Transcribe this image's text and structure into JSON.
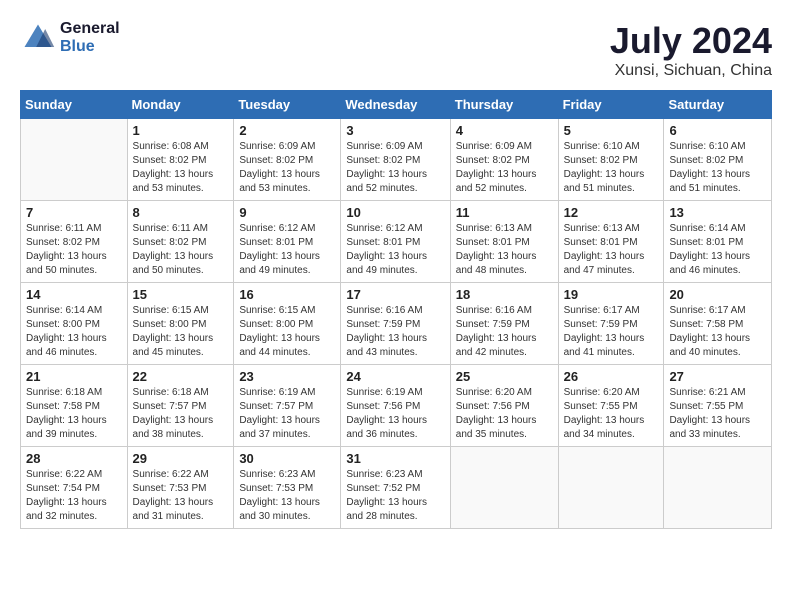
{
  "logo": {
    "line1": "General",
    "line2": "Blue"
  },
  "title": "July 2024",
  "subtitle": "Xunsi, Sichuan, China",
  "days_of_week": [
    "Sunday",
    "Monday",
    "Tuesday",
    "Wednesday",
    "Thursday",
    "Friday",
    "Saturday"
  ],
  "weeks": [
    [
      {
        "day": "",
        "detail": ""
      },
      {
        "day": "1",
        "detail": "Sunrise: 6:08 AM\nSunset: 8:02 PM\nDaylight: 13 hours\nand 53 minutes."
      },
      {
        "day": "2",
        "detail": "Sunrise: 6:09 AM\nSunset: 8:02 PM\nDaylight: 13 hours\nand 53 minutes."
      },
      {
        "day": "3",
        "detail": "Sunrise: 6:09 AM\nSunset: 8:02 PM\nDaylight: 13 hours\nand 52 minutes."
      },
      {
        "day": "4",
        "detail": "Sunrise: 6:09 AM\nSunset: 8:02 PM\nDaylight: 13 hours\nand 52 minutes."
      },
      {
        "day": "5",
        "detail": "Sunrise: 6:10 AM\nSunset: 8:02 PM\nDaylight: 13 hours\nand 51 minutes."
      },
      {
        "day": "6",
        "detail": "Sunrise: 6:10 AM\nSunset: 8:02 PM\nDaylight: 13 hours\nand 51 minutes."
      }
    ],
    [
      {
        "day": "7",
        "detail": "Sunrise: 6:11 AM\nSunset: 8:02 PM\nDaylight: 13 hours\nand 50 minutes."
      },
      {
        "day": "8",
        "detail": "Sunrise: 6:11 AM\nSunset: 8:02 PM\nDaylight: 13 hours\nand 50 minutes."
      },
      {
        "day": "9",
        "detail": "Sunrise: 6:12 AM\nSunset: 8:01 PM\nDaylight: 13 hours\nand 49 minutes."
      },
      {
        "day": "10",
        "detail": "Sunrise: 6:12 AM\nSunset: 8:01 PM\nDaylight: 13 hours\nand 49 minutes."
      },
      {
        "day": "11",
        "detail": "Sunrise: 6:13 AM\nSunset: 8:01 PM\nDaylight: 13 hours\nand 48 minutes."
      },
      {
        "day": "12",
        "detail": "Sunrise: 6:13 AM\nSunset: 8:01 PM\nDaylight: 13 hours\nand 47 minutes."
      },
      {
        "day": "13",
        "detail": "Sunrise: 6:14 AM\nSunset: 8:01 PM\nDaylight: 13 hours\nand 46 minutes."
      }
    ],
    [
      {
        "day": "14",
        "detail": "Sunrise: 6:14 AM\nSunset: 8:00 PM\nDaylight: 13 hours\nand 46 minutes."
      },
      {
        "day": "15",
        "detail": "Sunrise: 6:15 AM\nSunset: 8:00 PM\nDaylight: 13 hours\nand 45 minutes."
      },
      {
        "day": "16",
        "detail": "Sunrise: 6:15 AM\nSunset: 8:00 PM\nDaylight: 13 hours\nand 44 minutes."
      },
      {
        "day": "17",
        "detail": "Sunrise: 6:16 AM\nSunset: 7:59 PM\nDaylight: 13 hours\nand 43 minutes."
      },
      {
        "day": "18",
        "detail": "Sunrise: 6:16 AM\nSunset: 7:59 PM\nDaylight: 13 hours\nand 42 minutes."
      },
      {
        "day": "19",
        "detail": "Sunrise: 6:17 AM\nSunset: 7:59 PM\nDaylight: 13 hours\nand 41 minutes."
      },
      {
        "day": "20",
        "detail": "Sunrise: 6:17 AM\nSunset: 7:58 PM\nDaylight: 13 hours\nand 40 minutes."
      }
    ],
    [
      {
        "day": "21",
        "detail": "Sunrise: 6:18 AM\nSunset: 7:58 PM\nDaylight: 13 hours\nand 39 minutes."
      },
      {
        "day": "22",
        "detail": "Sunrise: 6:18 AM\nSunset: 7:57 PM\nDaylight: 13 hours\nand 38 minutes."
      },
      {
        "day": "23",
        "detail": "Sunrise: 6:19 AM\nSunset: 7:57 PM\nDaylight: 13 hours\nand 37 minutes."
      },
      {
        "day": "24",
        "detail": "Sunrise: 6:19 AM\nSunset: 7:56 PM\nDaylight: 13 hours\nand 36 minutes."
      },
      {
        "day": "25",
        "detail": "Sunrise: 6:20 AM\nSunset: 7:56 PM\nDaylight: 13 hours\nand 35 minutes."
      },
      {
        "day": "26",
        "detail": "Sunrise: 6:20 AM\nSunset: 7:55 PM\nDaylight: 13 hours\nand 34 minutes."
      },
      {
        "day": "27",
        "detail": "Sunrise: 6:21 AM\nSunset: 7:55 PM\nDaylight: 13 hours\nand 33 minutes."
      }
    ],
    [
      {
        "day": "28",
        "detail": "Sunrise: 6:22 AM\nSunset: 7:54 PM\nDaylight: 13 hours\nand 32 minutes."
      },
      {
        "day": "29",
        "detail": "Sunrise: 6:22 AM\nSunset: 7:53 PM\nDaylight: 13 hours\nand 31 minutes."
      },
      {
        "day": "30",
        "detail": "Sunrise: 6:23 AM\nSunset: 7:53 PM\nDaylight: 13 hours\nand 30 minutes."
      },
      {
        "day": "31",
        "detail": "Sunrise: 6:23 AM\nSunset: 7:52 PM\nDaylight: 13 hours\nand 28 minutes."
      },
      {
        "day": "",
        "detail": ""
      },
      {
        "day": "",
        "detail": ""
      },
      {
        "day": "",
        "detail": ""
      }
    ]
  ]
}
